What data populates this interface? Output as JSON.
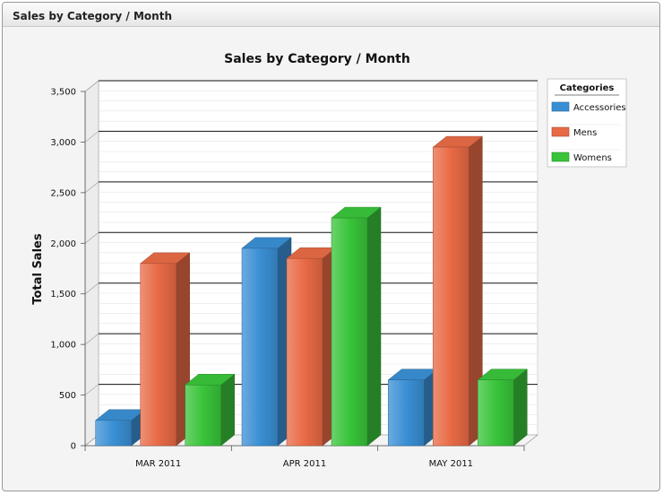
{
  "region": {
    "title": "Sales by Category / Month"
  },
  "chart_data": {
    "type": "bar",
    "title": "Sales by Category / Month",
    "xlabel": "",
    "ylabel": "Total Sales",
    "ylim": [
      0,
      3500
    ],
    "yticks": [
      "0",
      "500",
      "1,000",
      "1,500",
      "2,000",
      "2,500",
      "3,000",
      "3,500"
    ],
    "categories": [
      "MAR 2011",
      "APR 2011",
      "MAY 2011"
    ],
    "legend_title": "Categories",
    "legend_position": "top-right",
    "series": [
      {
        "name": "Accessories",
        "values": [
          250,
          1950,
          650
        ],
        "color": "#3a8fd4"
      },
      {
        "name": "Mens",
        "values": [
          1800,
          1850,
          2950
        ],
        "color": "#e86a45"
      },
      {
        "name": "Womens",
        "values": [
          600,
          2250,
          650
        ],
        "color": "#39c43a"
      }
    ]
  }
}
